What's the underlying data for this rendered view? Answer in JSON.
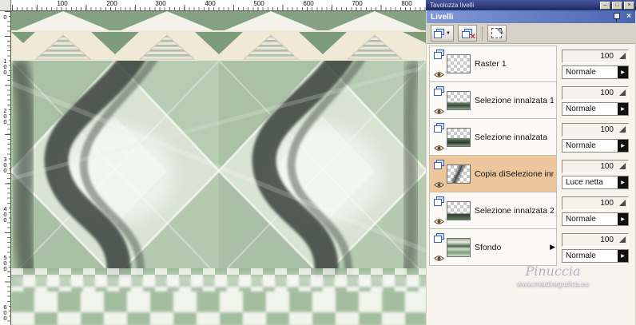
{
  "titlebar": {
    "title": "Tavolozza livelli",
    "buttons": {
      "minimize": "–",
      "restore": "□",
      "close": "×"
    }
  },
  "rulers": {
    "horizontal": [
      "100",
      "200",
      "300",
      "400",
      "500",
      "600",
      "700",
      "800"
    ],
    "vertical": [
      "0",
      "100",
      "200",
      "300",
      "400",
      "500",
      "600"
    ]
  },
  "layers_panel": {
    "title": "Livelli",
    "close_glyph": "×",
    "layers": [
      {
        "name": "Raster 1",
        "opacity": "100",
        "blend": "Normale"
      },
      {
        "name": "Selezione innalzata 1",
        "opacity": "100",
        "blend": "Normale"
      },
      {
        "name": "Selezione innalzata",
        "opacity": "100",
        "blend": "Normale"
      },
      {
        "name": "Copia diSelezione inn",
        "opacity": "100",
        "blend": "Luce netta"
      },
      {
        "name": "Selezione innalzata 2",
        "opacity": "100",
        "blend": "Normale"
      },
      {
        "name": "Sfondo",
        "opacity": "100",
        "blend": "Normale"
      }
    ]
  },
  "icons": {
    "new_layer_arrow": "▼",
    "delete_x": "×",
    "edit_pencil": "✎",
    "blend_arrow": "▶",
    "expand_arrow": "▶"
  },
  "watermark": {
    "name": "Pinuccia",
    "site": "www.maidiregrafica.eu"
  }
}
